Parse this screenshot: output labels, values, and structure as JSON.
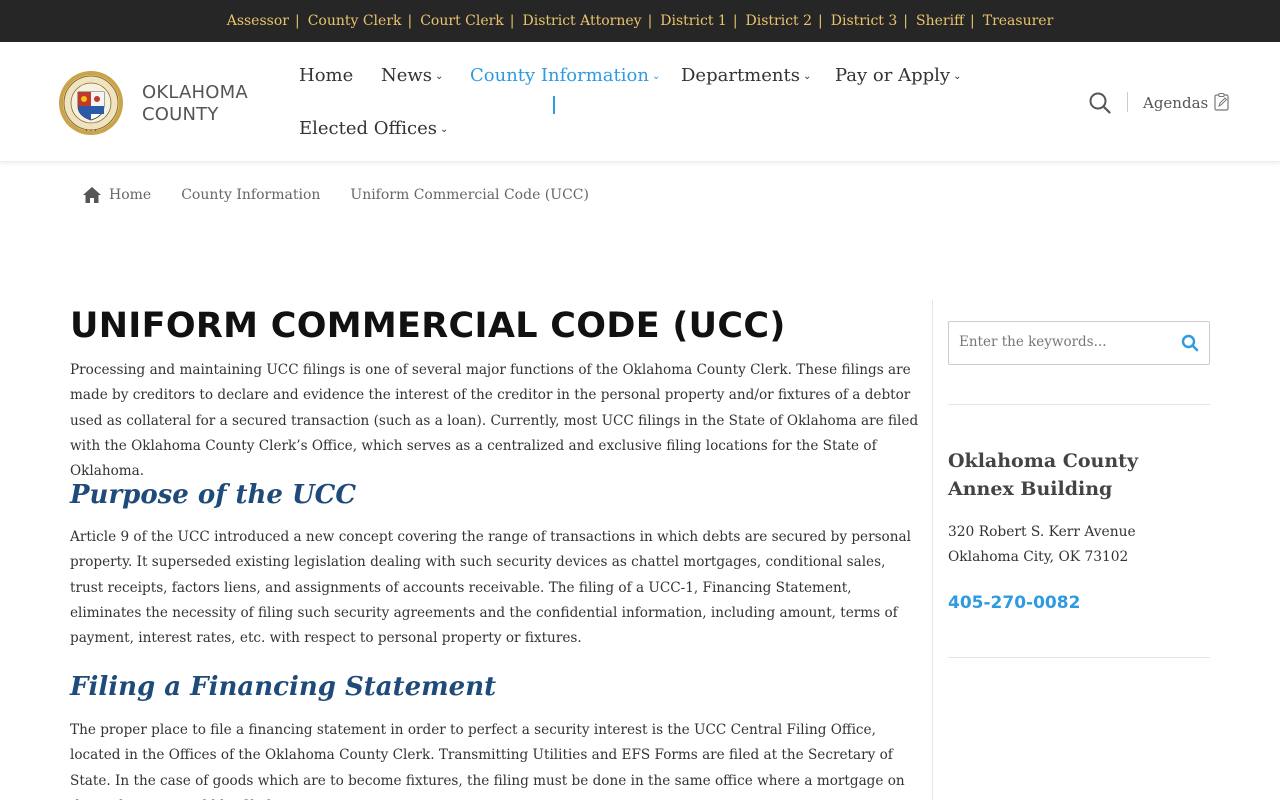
{
  "topbar": {
    "links": [
      {
        "label": "Assessor"
      },
      {
        "label": "County Clerk"
      },
      {
        "label": "Court Clerk"
      },
      {
        "label": "District Attorney"
      },
      {
        "label": "District 1"
      },
      {
        "label": "District 2"
      },
      {
        "label": "District 3"
      },
      {
        "label": "Sheriff"
      },
      {
        "label": "Treasurer"
      }
    ],
    "separator": "|"
  },
  "header": {
    "logo": {
      "line1": "OKLAHOMA",
      "line2": "COUNTY",
      "icon": "county-seal"
    },
    "nav": [
      {
        "label": "Home",
        "dropdown": false
      },
      {
        "label": "News",
        "dropdown": true
      },
      {
        "label": "County Information",
        "dropdown": true,
        "active": true
      },
      {
        "label": "Departments",
        "dropdown": true
      },
      {
        "label": "Pay or Apply",
        "dropdown": true
      },
      {
        "label": "Elected Offices",
        "dropdown": true
      }
    ],
    "chevron": "⌄",
    "search_icon": "magnifier",
    "agendas_label": "Agendas",
    "agendas_icon": "clipboard-edit"
  },
  "breadcrumb": {
    "items": [
      {
        "label": "Home",
        "icon": "home"
      },
      {
        "label": "County Information"
      },
      {
        "label": "Uniform Commercial Code (UCC)"
      }
    ]
  },
  "main": {
    "title": "UNIFORM COMMERCIAL CODE (UCC)",
    "intro": "Processing and maintaining UCC filings is one of several major functions of the  Oklahoma County Clerk. These filings are made by creditors to declare and evidence the interest of the creditor in the personal property and/or fixtures of a debtor used as collateral for a secured transaction (such as a loan). Currently, most UCC filings in the State of Oklahoma are filed with the Oklahoma County Clerk’s Office, which serves as a centralized and exclusive filing locations for the State of Oklahoma.",
    "sections": [
      {
        "heading": "Purpose of the UCC",
        "body": "Article 9 of the UCC introduced a new concept covering the range of transactions in which debts are secured by personal property. It superseded existing legislation dealing with such security devices as chattel mortgages, conditional sales, trust receipts, factors liens, and assignments of accounts receivable. The filing of a UCC-1, Financing Statement, eliminates the necessity of filing such security agreements and the confidential information, including amount, terms of payment, interest rates, etc. with respect to personal property or fixtures."
      },
      {
        "heading": "Filing a Financing Statement",
        "body": "The proper place to file a financing statement in order to perfect a security interest is the UCC Central Filing Office, located in the Offices of the Oklahoma County Clerk. Transmitting Utilities and EFS Forms are filed at the Secretary of State. In the case of goods which are to become fixtures, the filing must be done in the same office where a mortgage on the real estate would be filed."
      }
    ]
  },
  "sidebar": {
    "search": {
      "placeholder": "Enter the keywords...",
      "value": "",
      "icon": "magnifier"
    },
    "annex": {
      "title": "Oklahoma County Annex Building",
      "address_line1": "320 Robert S. Kerr Avenue",
      "address_line2": "Oklahoma City, OK 73102",
      "phone": "405-270-0082"
    }
  },
  "colors": {
    "topbar_bg": "#262626",
    "topbar_link": "#e8c36a",
    "accent": "#2e9be0",
    "heading_blue": "#1f4b7a"
  }
}
